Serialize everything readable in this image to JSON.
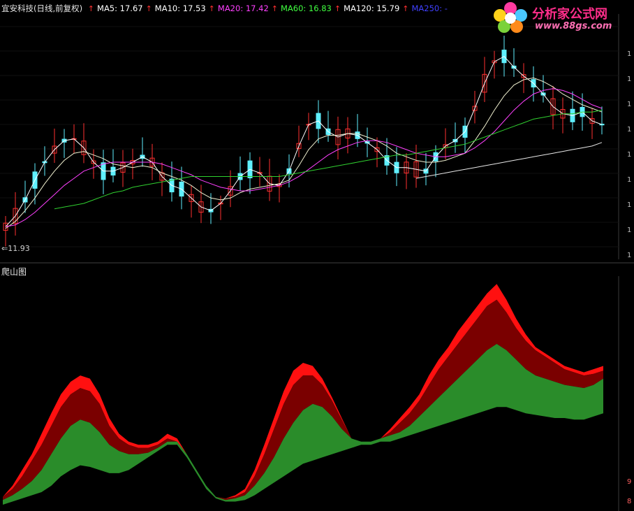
{
  "header": {
    "stock_name": "宜安科技(日线,前复权)",
    "ma_items": [
      {
        "label": "MA5: 17.67",
        "color": "#ffffff"
      },
      {
        "label": "MA10: 17.53",
        "color": "#ffffff"
      },
      {
        "label": "MA20: 17.42",
        "color": "#ff40ff"
      },
      {
        "label": "MA60: 16.83",
        "color": "#40ff40"
      },
      {
        "label": "MA120: 15.79",
        "color": "#ffffff"
      },
      {
        "label": "MA250: -",
        "color": "#4040ff"
      }
    ]
  },
  "lower_pane_title": "爬山图",
  "low_price_label": "11.93",
  "logo": {
    "name": "分析家公式网",
    "url": "www.88gs.com"
  },
  "colors": {
    "up": "#ff3030",
    "down": "#5ff0ff",
    "red_fill": "#ff1010",
    "dark_fill": "#7a0000",
    "green_fill": "#2a8c2a"
  },
  "chart_data": [
    {
      "type": "candlestick",
      "title": "宜安科技(日线,前复权)",
      "series": [
        {
          "name": "MA5",
          "values": [
            12.0,
            12.6,
            13.5,
            14.6,
            15.6,
            16.3,
            16.8,
            16.9,
            16.4,
            15.6,
            15.1,
            15.1,
            15.3,
            15.6,
            15.9,
            15.6,
            14.8,
            14.3,
            14.1,
            13.6,
            13.1,
            12.9,
            13.3,
            14.0,
            14.8,
            15.2,
            15.0,
            14.4,
            14.3,
            15.1,
            16.5,
            17.7,
            17.9,
            17.3,
            17.0,
            17.2,
            17.1,
            16.7,
            16.3,
            15.7,
            15.3,
            15.3,
            15.2,
            15.1,
            15.9,
            16.5,
            16.8,
            17.3,
            18.6,
            20.0,
            21.2,
            21.5,
            20.9,
            20.4,
            20.0,
            19.4,
            18.7,
            18.3,
            18.2,
            18.4,
            17.9,
            17.7
          ]
        },
        {
          "name": "MA10",
          "values": [
            11.9,
            12.3,
            12.9,
            13.6,
            14.4,
            15.1,
            15.7,
            16.1,
            16.2,
            16.0,
            15.8,
            15.5,
            15.4,
            15.3,
            15.4,
            15.3,
            15.0,
            14.8,
            14.6,
            14.3,
            13.9,
            13.6,
            13.5,
            13.6,
            13.9,
            14.1,
            14.2,
            14.3,
            14.4,
            14.6,
            15.4,
            16.3,
            16.9,
            17.1,
            17.1,
            17.2,
            17.2,
            17.0,
            16.8,
            16.5,
            16.1,
            15.9,
            15.7,
            15.6,
            15.6,
            15.7,
            15.9,
            16.1,
            16.8,
            17.6,
            18.5,
            19.3,
            19.9,
            20.2,
            20.3,
            20.1,
            19.8,
            19.4,
            19.1,
            18.8,
            18.6,
            18.4
          ]
        },
        {
          "name": "MA20",
          "values": [
            12.0,
            12.1,
            12.4,
            12.8,
            13.3,
            13.8,
            14.3,
            14.7,
            15.1,
            15.3,
            15.5,
            15.6,
            15.6,
            15.6,
            15.6,
            15.6,
            15.5,
            15.3,
            15.1,
            14.9,
            14.6,
            14.4,
            14.2,
            14.1,
            14.0,
            14.0,
            14.1,
            14.2,
            14.3,
            14.5,
            14.8,
            15.2,
            15.6,
            16.0,
            16.3,
            16.5,
            16.7,
            16.8,
            16.8,
            16.7,
            16.5,
            16.3,
            16.1,
            16.0,
            15.9,
            15.9,
            16.0,
            16.1,
            16.4,
            16.8,
            17.3,
            17.9,
            18.5,
            19.0,
            19.4,
            19.6,
            19.7,
            19.6,
            19.4,
            19.1,
            18.8,
            18.6
          ]
        },
        {
          "name": "MA60",
          "values": [
            null,
            null,
            null,
            null,
            null,
            13.0,
            13.1,
            13.2,
            13.3,
            13.5,
            13.7,
            13.9,
            14.0,
            14.2,
            14.3,
            14.4,
            14.5,
            14.6,
            14.7,
            14.8,
            14.8,
            14.8,
            14.8,
            14.8,
            14.8,
            14.8,
            14.8,
            14.8,
            14.8,
            14.9,
            15.0,
            15.1,
            15.2,
            15.3,
            15.4,
            15.5,
            15.6,
            15.7,
            15.8,
            15.9,
            16.0,
            16.0,
            16.1,
            16.2,
            16.3,
            16.4,
            16.5,
            16.6,
            16.8,
            17.0,
            17.2,
            17.4,
            17.6,
            17.8,
            18.0,
            18.1,
            18.2,
            18.3,
            18.3,
            18.4,
            18.4,
            18.5
          ]
        },
        {
          "name": "MA120",
          "values": [
            null,
            null,
            null,
            null,
            null,
            null,
            null,
            null,
            null,
            null,
            null,
            null,
            null,
            null,
            null,
            null,
            null,
            null,
            null,
            null,
            null,
            null,
            null,
            null,
            null,
            null,
            null,
            null,
            null,
            null,
            null,
            null,
            null,
            null,
            null,
            null,
            null,
            null,
            null,
            null,
            null,
            null,
            14.7,
            14.8,
            14.9,
            15.0,
            15.1,
            15.2,
            15.3,
            15.4,
            15.5,
            15.6,
            15.7,
            15.8,
            15.9,
            16.0,
            16.1,
            16.2,
            16.3,
            16.4,
            16.5,
            16.7
          ]
        }
      ]
    },
    {
      "type": "area",
      "title": "爬山图",
      "series": [
        {
          "name": "red",
          "values": [
            5,
            12,
            22,
            32,
            45,
            58,
            70,
            78,
            82,
            80,
            70,
            55,
            45,
            40,
            38,
            38,
            40,
            45,
            42,
            32,
            22,
            12,
            5,
            4,
            6,
            10,
            22,
            38,
            55,
            72,
            85,
            90,
            88,
            80,
            68,
            55,
            42,
            40,
            40,
            42,
            48,
            55,
            62,
            70,
            82,
            92,
            100,
            110,
            118,
            126,
            134,
            140,
            130,
            118,
            108,
            100,
            96,
            92,
            88,
            86,
            84,
            86,
            88
          ]
        },
        {
          "name": "dark",
          "values": [
            5,
            10,
            18,
            28,
            38,
            50,
            62,
            70,
            74,
            72,
            64,
            50,
            42,
            38,
            36,
            36,
            38,
            42,
            40,
            32,
            22,
            12,
            5,
            4,
            5,
            8,
            18,
            32,
            48,
            64,
            76,
            82,
            82,
            76,
            66,
            54,
            42,
            40,
            40,
            42,
            46,
            52,
            58,
            66,
            76,
            86,
            94,
            102,
            110,
            118,
            126,
            130,
            122,
            112,
            104,
            98,
            94,
            90,
            86,
            84,
            82,
            83,
            85
          ]
        },
        {
          "name": "green",
          "values": [
            3,
            6,
            10,
            15,
            22,
            32,
            42,
            50,
            54,
            52,
            46,
            38,
            34,
            32,
            32,
            33,
            36,
            40,
            40,
            32,
            22,
            12,
            5,
            3,
            4,
            6,
            12,
            20,
            30,
            42,
            52,
            60,
            64,
            62,
            56,
            48,
            42,
            40,
            40,
            42,
            44,
            46,
            50,
            56,
            62,
            68,
            74,
            80,
            86,
            92,
            98,
            102,
            98,
            92,
            86,
            82,
            80,
            78,
            76,
            75,
            74,
            76,
            80
          ]
        },
        {
          "name": "base",
          "values": [
            0,
            2,
            4,
            6,
            8,
            12,
            18,
            22,
            25,
            24,
            22,
            20,
            20,
            22,
            26,
            30,
            34,
            38,
            38,
            30,
            20,
            10,
            4,
            2,
            2,
            3,
            6,
            10,
            14,
            18,
            22,
            26,
            28,
            30,
            32,
            34,
            36,
            38,
            38,
            40,
            40,
            42,
            44,
            46,
            48,
            50,
            52,
            54,
            56,
            58,
            60,
            62,
            62,
            60,
            58,
            57,
            56,
            55,
            55,
            54,
            54,
            56,
            58
          ]
        }
      ]
    }
  ]
}
